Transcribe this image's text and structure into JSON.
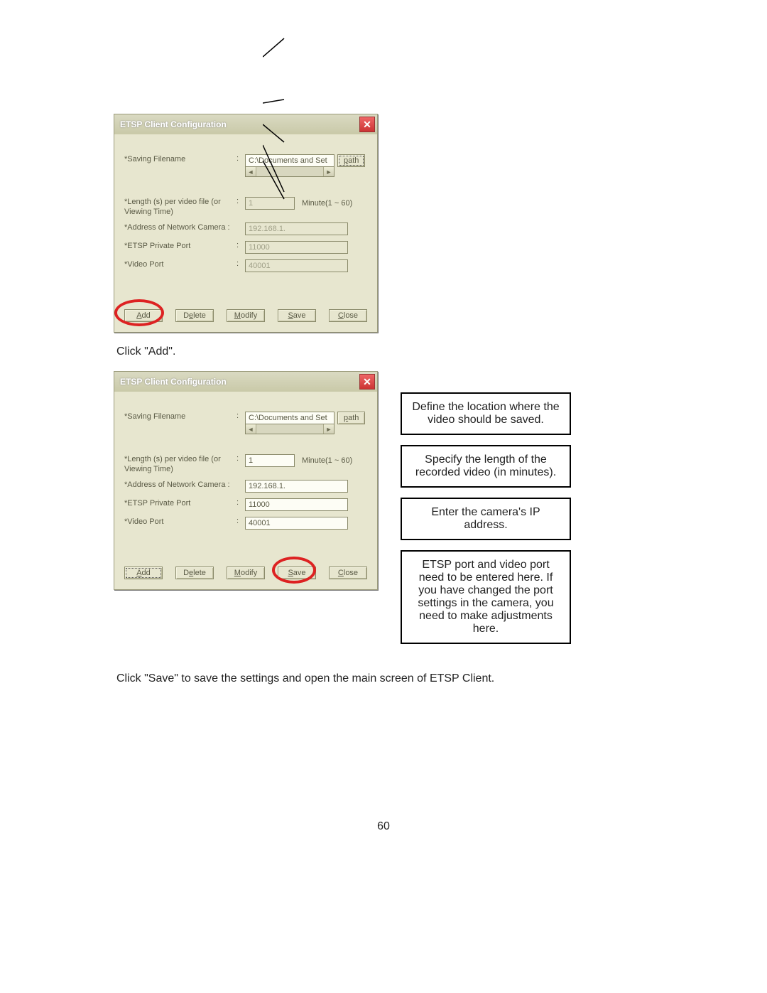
{
  "dialog1": {
    "title": "ETSP Client Configuration",
    "labels": {
      "filename": "*Saving Filename",
      "length": "*Length (s) per video file (or Viewing Time)",
      "address": "*Address of Network Camera :",
      "etspPort": "*ETSP Private Port",
      "videoPort": "*Video Port"
    },
    "values": {
      "filename": "C:\\Documents and Set",
      "length": "1",
      "address": "192.168.1.",
      "etspPort": "11000",
      "videoPort": "40001"
    },
    "minute": "Minute(1 ~ 60)",
    "buttons": {
      "path": "path",
      "add": "Add",
      "delete": "Delete",
      "modify": "Modify",
      "save": "Save",
      "close": "Close"
    }
  },
  "instruction1": "Click \"Add\".",
  "dialog2": {
    "values": {
      "filename": "C:\\Documents and Set",
      "length": "1",
      "address": "192.168.1.",
      "etspPort": "11000",
      "videoPort": "40001"
    }
  },
  "callouts": {
    "c1": "Define the location where the video should be saved.",
    "c2": "Specify the length of the recorded video (in minutes).",
    "c3": "Enter the camera's IP address.",
    "c4": "ETSP port and video port need to be entered here. If you have changed the port settings in the camera, you need to make adjustments here."
  },
  "instruction2": "Click \"Save\" to save the settings and open the main screen of ETSP Client.",
  "pageNumber": "60"
}
